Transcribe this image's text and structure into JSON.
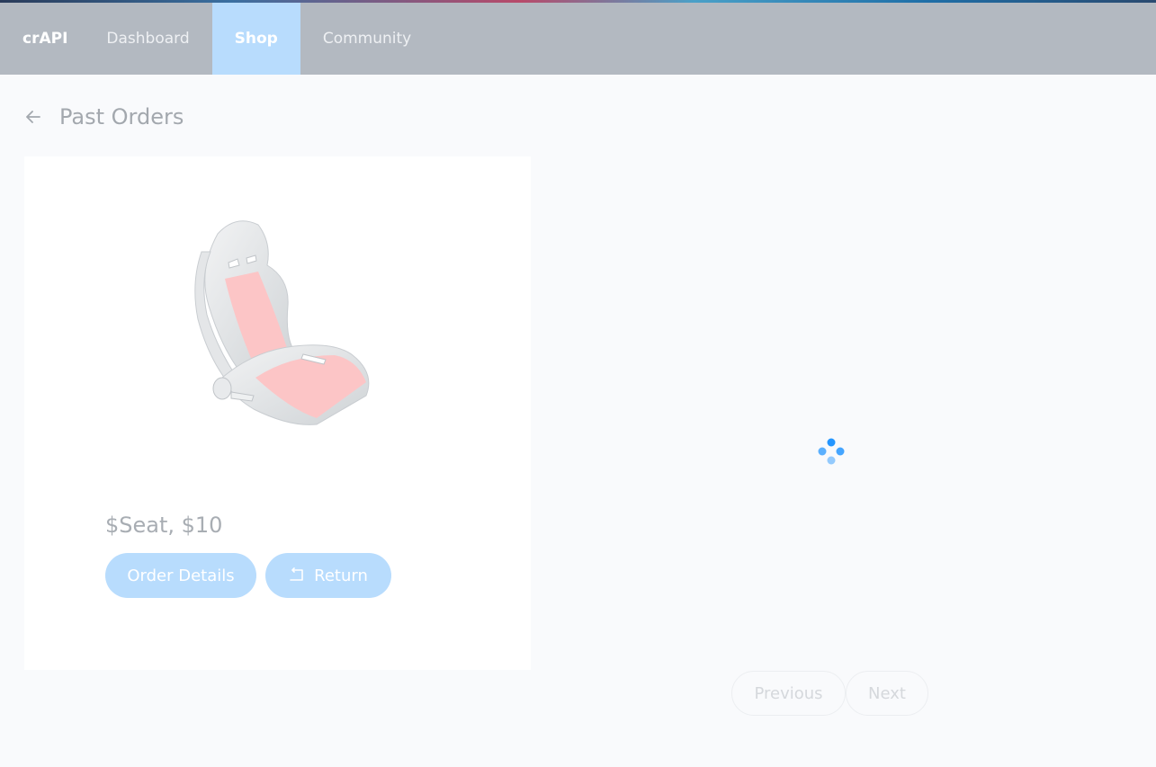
{
  "nav": {
    "brand": "crAPI",
    "items": [
      {
        "label": "Dashboard"
      },
      {
        "label": "Shop"
      },
      {
        "label": "Community"
      }
    ]
  },
  "page": {
    "title": "Past Orders"
  },
  "order": {
    "product_title": "$Seat, $10",
    "details_button": "Order Details",
    "return_button": "Return"
  },
  "pagination": {
    "previous": "Previous",
    "next": "Next"
  },
  "colors": {
    "navbar": "#b3b9c1",
    "active_tab": "#b8dcfd",
    "button": "#b8dcfd",
    "spinner": "#1890ff"
  },
  "icons": {
    "back": "arrow-left-icon",
    "return": "rollback-icon",
    "loading": "spinner-icon"
  }
}
